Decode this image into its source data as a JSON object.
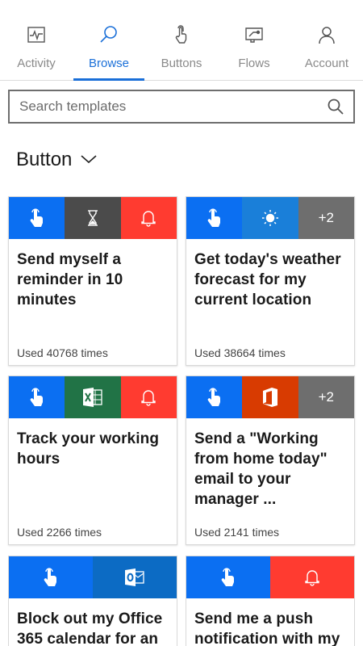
{
  "nav": {
    "activity": "Activity",
    "browse": "Browse",
    "buttons": "Buttons",
    "flows": "Flows",
    "account": "Account"
  },
  "search": {
    "placeholder": "Search templates"
  },
  "category": {
    "title": "Button"
  },
  "colors": {
    "accent": "#1a6fd8",
    "button_blue": "#0b6ff2",
    "timer_gray": "#4b4b4b",
    "notify_red": "#ff3b30",
    "weather_blue": "#1a7fd9",
    "more_gray": "#6e6e6e",
    "excel_green": "#217346",
    "office_orange": "#d83b01",
    "outlook_blue": "#0c6bc4"
  },
  "cards": [
    {
      "title": "Send myself a reminder in 10 minutes",
      "used": "Used 40768 times",
      "icons": [
        "touch-icon",
        "hourglass-icon",
        "bell-icon"
      ]
    },
    {
      "title": "Get today's weather forecast for my current location",
      "used": "Used 38664 times",
      "icons": [
        "touch-icon",
        "sun-icon",
        "more-count"
      ],
      "more": "+2"
    },
    {
      "title": "Track your working hours",
      "used": "Used 2266 times",
      "icons": [
        "touch-icon",
        "excel-icon",
        "bell-icon"
      ]
    },
    {
      "title": "Send a \"Working from home today\" email to your manager ...",
      "used": "Used 2141 times",
      "icons": [
        "touch-icon",
        "office-icon",
        "more-count"
      ],
      "more": "+2"
    },
    {
      "title": "Block out my Office 365 calendar for an",
      "icons": [
        "touch-icon",
        "outlook-icon"
      ]
    },
    {
      "title": "Send me a push notification with my",
      "icons": [
        "touch-icon",
        "bell-icon"
      ]
    }
  ]
}
